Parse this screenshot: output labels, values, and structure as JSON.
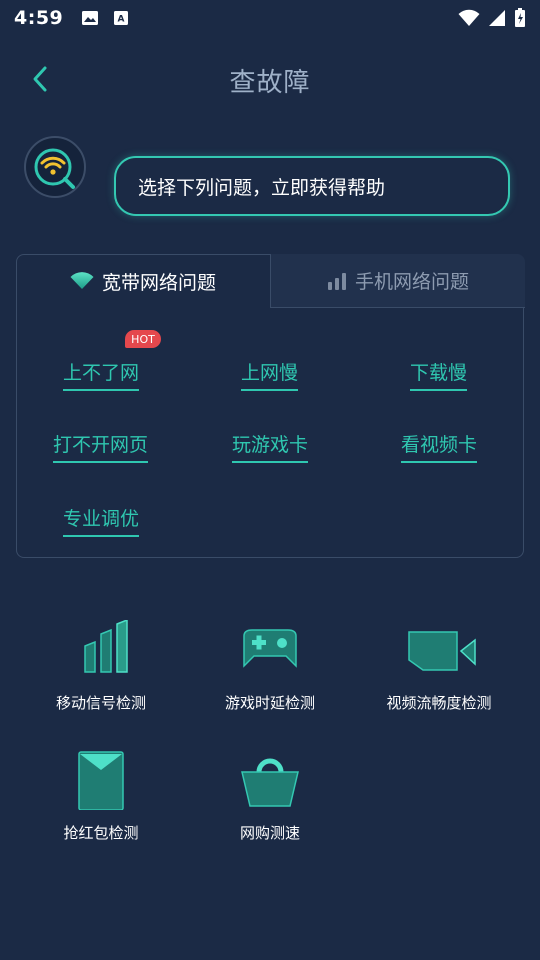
{
  "status_bar": {
    "time": "4:59",
    "left_icons": [
      "image-icon",
      "font-download-icon"
    ],
    "right_icons": [
      "wifi-icon",
      "signal-icon",
      "battery-icon"
    ]
  },
  "header": {
    "title": "查故障",
    "back_icon": "back-chevron-icon"
  },
  "hint": {
    "text": "选择下列问题，立即获得帮助"
  },
  "tabs": [
    {
      "label": "宽带网络问题",
      "icon": "wifi-icon",
      "active": true
    },
    {
      "label": "手机网络问题",
      "icon": "signal-bars-icon",
      "active": false
    }
  ],
  "issues": [
    {
      "label": "上不了网",
      "badge": "HOT"
    },
    {
      "label": "上网慢"
    },
    {
      "label": "下载慢"
    },
    {
      "label": "打不开网页"
    },
    {
      "label": "玩游戏卡"
    },
    {
      "label": "看视频卡"
    },
    {
      "label": "专业调优"
    }
  ],
  "tools": [
    {
      "label": "移动信号检测",
      "icon": "signal-bars-icon"
    },
    {
      "label": "游戏时延检测",
      "icon": "gamepad-icon"
    },
    {
      "label": "视频流畅度检测",
      "icon": "video-camera-icon"
    },
    {
      "label": "抢红包检测",
      "icon": "red-envelope-icon"
    },
    {
      "label": "网购测速",
      "icon": "shopping-bag-icon"
    }
  ],
  "colors": {
    "background": "#1b2a45",
    "accent": "#2fc7b0",
    "hot_badge": "#e5484d",
    "wifi_yellow": "#f2c230"
  }
}
